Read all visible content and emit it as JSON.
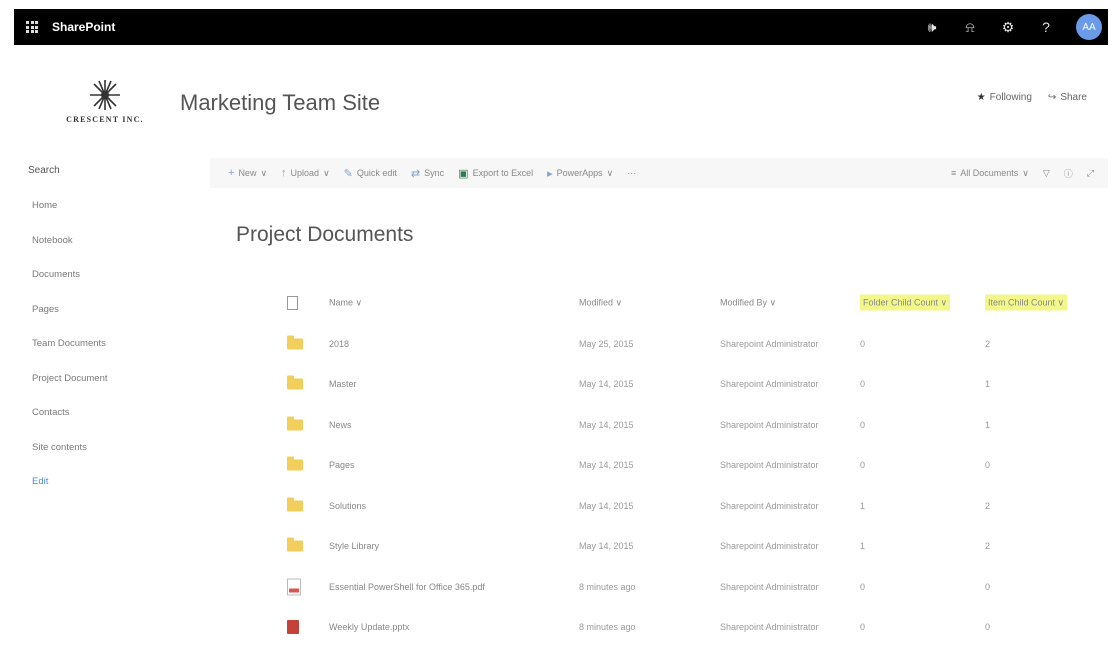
{
  "suitebar": {
    "app_name": "SharePoint",
    "icons": [
      "megaphone-icon",
      "bell-icon",
      "gear-icon",
      "help-icon"
    ],
    "avatar_initials": "AA"
  },
  "site": {
    "logo_text": "CRESCENT INC.",
    "title": "Marketing Team Site",
    "following_label": "Following",
    "share_label": "Share"
  },
  "leftnav": {
    "search_placeholder": "Search",
    "items": [
      "Home",
      "Notebook",
      "Documents",
      "Pages",
      "Team Documents",
      "Project Document",
      "Contacts",
      "Site contents"
    ],
    "edit_label": "Edit"
  },
  "commandbar": {
    "new_label": "New",
    "upload_label": "Upload",
    "quickedit_label": "Quick edit",
    "sync_label": "Sync",
    "export_label": "Export to Excel",
    "powerapps_label": "PowerApps",
    "more_label": "···",
    "view_label": "All Documents"
  },
  "library": {
    "title": "Project Documents",
    "columns": {
      "name": "Name",
      "modified": "Modified",
      "modified_by": "Modified By",
      "folder_child_count": "Folder Child Count",
      "item_child_count": "Item Child Count"
    },
    "rows": [
      {
        "type": "folder",
        "name": "2018",
        "modified": "May 25, 2015",
        "modified_by": "Sharepoint Administrator",
        "folder_child_count": "0",
        "item_child_count": "2"
      },
      {
        "type": "folder",
        "name": "Master",
        "modified": "May 14, 2015",
        "modified_by": "Sharepoint Administrator",
        "folder_child_count": "0",
        "item_child_count": "1"
      },
      {
        "type": "folder",
        "name": "News",
        "modified": "May 14, 2015",
        "modified_by": "Sharepoint Administrator",
        "folder_child_count": "0",
        "item_child_count": "1"
      },
      {
        "type": "folder",
        "name": "Pages",
        "modified": "May 14, 2015",
        "modified_by": "Sharepoint Administrator",
        "folder_child_count": "0",
        "item_child_count": "0"
      },
      {
        "type": "folder",
        "name": "Solutions",
        "modified": "May 14, 2015",
        "modified_by": "Sharepoint Administrator",
        "folder_child_count": "1",
        "item_child_count": "2"
      },
      {
        "type": "folder",
        "name": "Style Library",
        "modified": "May 14, 2015",
        "modified_by": "Sharepoint Administrator",
        "folder_child_count": "1",
        "item_child_count": "2"
      },
      {
        "type": "pdf",
        "name": "Essential PowerShell for Office 365.pdf",
        "modified": "8 minutes ago",
        "modified_by": "Sharepoint Administrator",
        "folder_child_count": "0",
        "item_child_count": "0"
      },
      {
        "type": "pptx",
        "name": "Weekly Update.pptx",
        "modified": "8 minutes ago",
        "modified_by": "Sharepoint Administrator",
        "folder_child_count": "0",
        "item_child_count": "0"
      }
    ]
  },
  "colors": {
    "suitebar_bg": "#000000",
    "highlight": "#f3f78a",
    "folder": "#f2cf5b",
    "link": "#4a90d9"
  }
}
